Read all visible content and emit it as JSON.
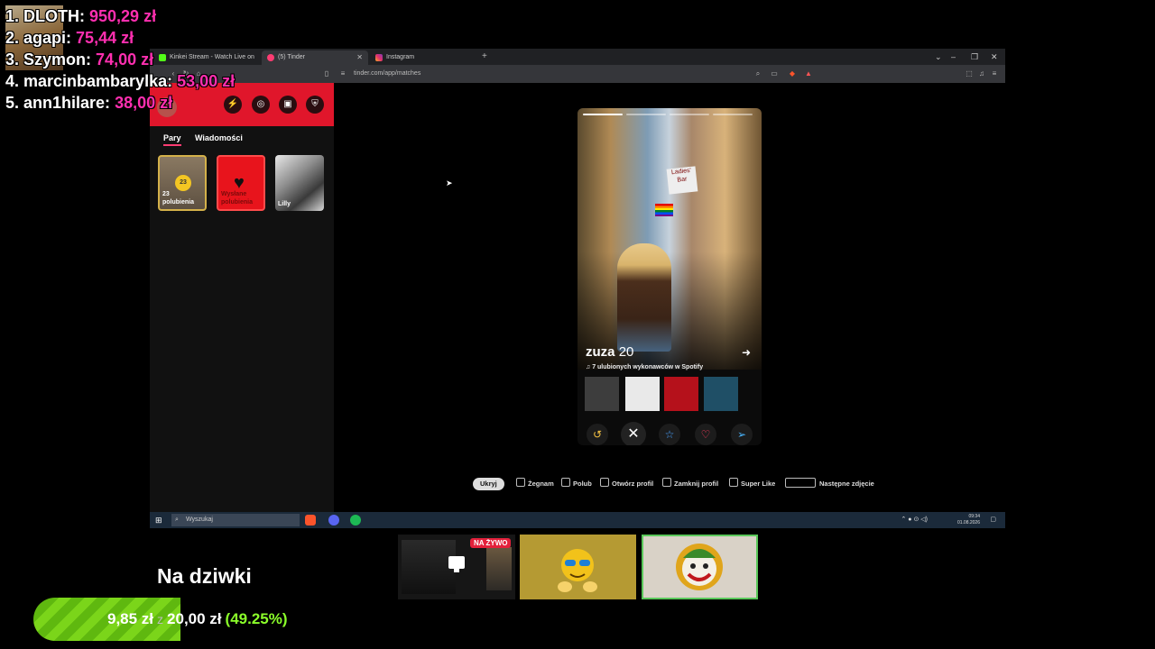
{
  "leaderboard": [
    {
      "name": "1. DLOTH:",
      "amount": "950,29 zł"
    },
    {
      "name": "2. agapi:",
      "amount": "75,44 zł"
    },
    {
      "name": "3. Szymon:",
      "amount": "74,00 zł"
    },
    {
      "name": "4. marcinbambarylka:",
      "amount": "53,00 zł"
    },
    {
      "name": "5. ann1hilare:",
      "amount": "38,00 zł"
    }
  ],
  "browser": {
    "tabs": [
      "Kinkei Stream - Watch Live on Kick",
      "(5) Tinder",
      "Instagram"
    ],
    "new_tab": "+",
    "url": "tinder.com/app/matches",
    "window_controls": [
      "⌄",
      "–",
      "❐",
      "✕"
    ]
  },
  "tinder": {
    "sidebar_tabs": [
      "Pary",
      "Wiadomości"
    ],
    "cards": {
      "likes_count": "23",
      "likes_label": "23 polubienia",
      "super_label": "Wysłane polubienia",
      "match_name": "Lilly"
    },
    "profile": {
      "name": "zuza",
      "age": "20",
      "spotify_line": "♫ 7 ulubionych wykonawców w Spotify",
      "sign_text": "Ladies' Bar",
      "album_colors": [
        "#3d3d3d",
        "#e9e9e9",
        "#b5111b",
        "#1f4f66"
      ]
    },
    "action_icons": [
      "rewind-icon",
      "close-icon",
      "star-icon",
      "heart-icon",
      "send-icon"
    ],
    "hints": {
      "hide": "Ukryj",
      "items": [
        "Żegnam",
        "Polub",
        "Otwórz profil",
        "Zamknij profil",
        "Super Like",
        "Następne zdjęcie"
      ]
    }
  },
  "taskbar": {
    "search_placeholder": "Wyszukaj",
    "time": "09:34",
    "date": "01.08.2026"
  },
  "goal": {
    "title": "Na dziwki",
    "current": "9,85 zł",
    "separator": "z",
    "target": "20,00 zł",
    "percent_text": "(49.25%)",
    "progress": 0.4925
  },
  "thumbnails": {
    "live_badge": "NA ŻYWO"
  }
}
